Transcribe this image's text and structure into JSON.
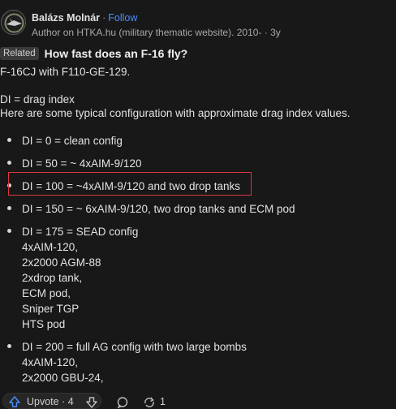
{
  "author": {
    "name": "Balázs Molnár",
    "separator": "·",
    "follow": "Follow",
    "credential": "Author on HTKA.hu (military thematic website). 2010- · 3y"
  },
  "related": {
    "badge": "Related",
    "question": "How fast does an F-16 fly?"
  },
  "body": {
    "line1": "F-16CJ with F110-GE-129.",
    "line2": "DI = drag index",
    "line3": "Here are some typical configuration with approximate drag index values.",
    "items": [
      {
        "lines": [
          "DI = 0 = clean config"
        ]
      },
      {
        "lines": [
          "DI = 50 = ~ 4xAIM-9/120"
        ]
      },
      {
        "lines": [
          "DI = 100 = ~4xAIM-9/120 and two drop tanks"
        ]
      },
      {
        "lines": [
          "DI = 150 = ~ 6xAIM-9/120, two drop tanks and ECM pod"
        ]
      },
      {
        "lines": [
          "DI = 175 = SEAD config",
          "4xAIM-120,",
          "2x2000 AGM-88",
          "2xdrop tank,",
          "ECM pod,",
          "Sniper TGP",
          "HTS pod"
        ]
      },
      {
        "lines": [
          "DI = 200 = full AG config with two large bombs",
          "4xAIM-120,",
          "2x2000 GBU-24,"
        ]
      }
    ]
  },
  "actions": {
    "upvote_label": "Upvote · 4",
    "share_count": "1"
  },
  "colors": {
    "background": "#181818",
    "accent": "#4c8dff",
    "highlight_border": "#d9383f"
  },
  "icons": [
    "avatar",
    "upvote-icon",
    "downvote-icon",
    "comment-icon",
    "share-icon"
  ]
}
